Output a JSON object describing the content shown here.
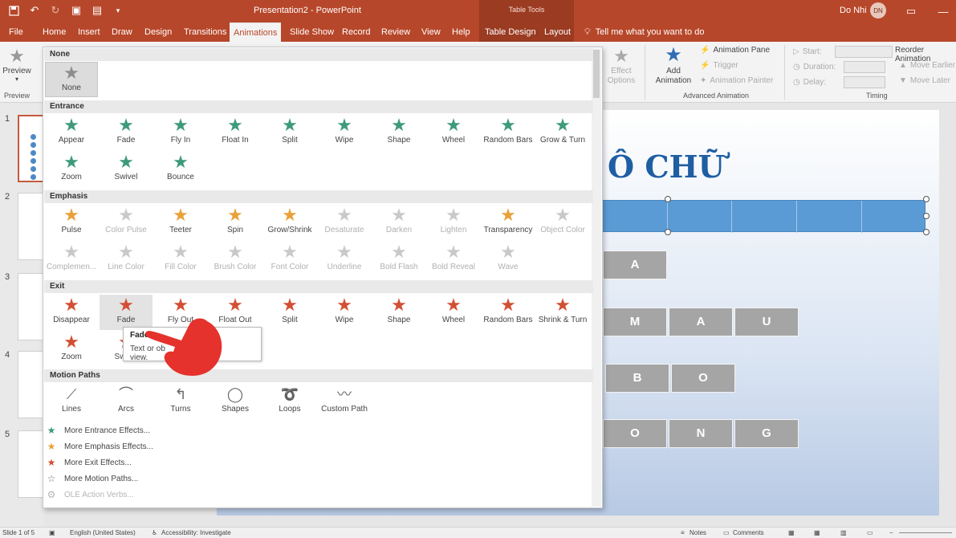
{
  "app": {
    "title": "Presentation2 - PowerPoint",
    "table_tools": "Table Tools",
    "user": "Do Nhi",
    "user_initials": "DN"
  },
  "tabs": [
    "File",
    "Home",
    "Insert",
    "Draw",
    "Design",
    "Transitions",
    "Animations",
    "Slide Show",
    "Record",
    "Review",
    "View",
    "Help",
    "Table Design",
    "Layout"
  ],
  "tell_me": "Tell me what you want to do",
  "ribbon": {
    "preview_label": "Preview",
    "preview_group": "Preview",
    "effect_options": "Effect Options",
    "add_animation": "Add Animation",
    "animation_pane": "Animation Pane",
    "trigger": "Trigger",
    "animation_painter": "Animation Painter",
    "advanced_group": "Advanced Animation",
    "start": "Start:",
    "duration": "Duration:",
    "delay": "Delay:",
    "timing_group": "Timing",
    "reorder": "Reorder Animation",
    "move_earlier": "Move Earlier",
    "move_later": "Move Later"
  },
  "gallery": {
    "none_header": "None",
    "none_item": "None",
    "entrance_header": "Entrance",
    "entrance": [
      "Appear",
      "Fade",
      "Fly In",
      "Float In",
      "Split",
      "Wipe",
      "Shape",
      "Wheel",
      "Random Bars",
      "Grow & Turn",
      "Zoom",
      "Swivel",
      "Bounce"
    ],
    "emphasis_header": "Emphasis",
    "emphasis": [
      "Pulse",
      "Color Pulse",
      "Teeter",
      "Spin",
      "Grow/Shrink",
      "Desaturate",
      "Darken",
      "Lighten",
      "Transparency",
      "Object Color",
      "Complemen...",
      "Line Color",
      "Fill Color",
      "Brush Color",
      "Font Color",
      "Underline",
      "Bold Flash",
      "Bold Reveal",
      "Wave"
    ],
    "exit_header": "Exit",
    "exit": [
      "Disappear",
      "Fade",
      "Fly Out",
      "Float Out",
      "Split",
      "Wipe",
      "Shape",
      "Wheel",
      "Random Bars",
      "Shrink & Turn",
      "Zoom",
      "Swivel"
    ],
    "paths_header": "Motion Paths",
    "paths": [
      "Lines",
      "Arcs",
      "Turns",
      "Shapes",
      "Loops",
      "Custom Path"
    ],
    "more": [
      "More Entrance Effects...",
      "More Emphasis Effects...",
      "More Exit Effects...",
      "More Motion Paths...",
      "OLE Action Verbs..."
    ]
  },
  "tooltip": {
    "title": "Fade",
    "body": "Text or ob",
    "body_tail": "view."
  },
  "slide": {
    "title": "Ô CHỮ",
    "row1": [
      "A"
    ],
    "row2": [
      "M",
      "A",
      "U"
    ],
    "row3": [
      "B",
      "O"
    ],
    "row4": [
      "O",
      "N",
      "G"
    ]
  },
  "thumbs": [
    "1",
    "2",
    "3",
    "4",
    "5"
  ],
  "status": {
    "slide": "Slide 1 of 5",
    "language": "English (United States)",
    "accessibility": "Accessibility: Investigate",
    "notes": "Notes",
    "comments": "Comments"
  },
  "colors": {
    "accent": "#b7472a",
    "entrance": "#3e9a7a",
    "emphasis": "#e9a13a",
    "exit": "#d24f33",
    "cell": "#a5a5a5",
    "table_blue": "#5b9bd5"
  }
}
